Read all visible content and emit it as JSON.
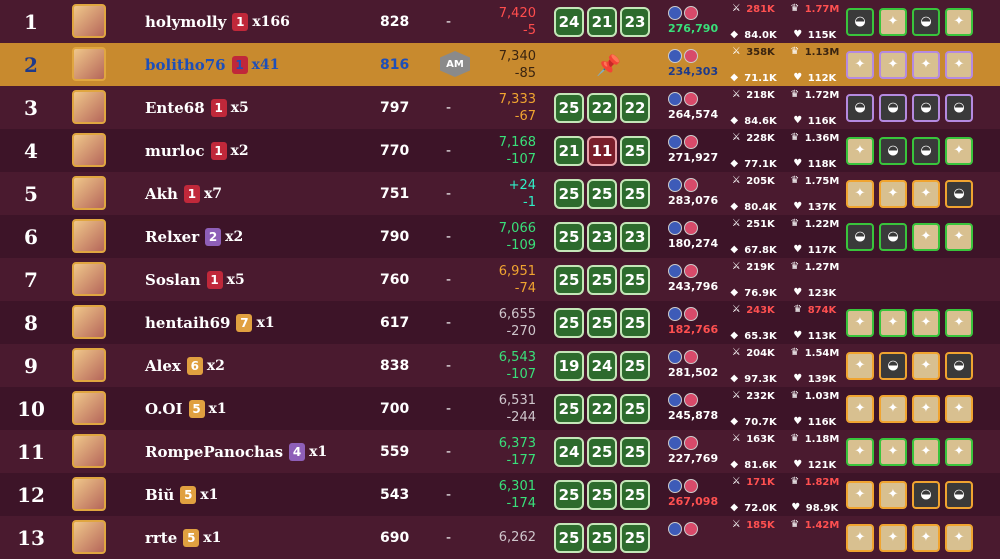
{
  "colors": {
    "accent": "#c88a2e",
    "green": "#39e07a",
    "red": "#ff4d4d"
  },
  "rows": [
    {
      "rank": "1",
      "name": "holymolly",
      "level": "1",
      "levelColor": "#c0283a",
      "mult": "x166",
      "rating": "828",
      "badge": "",
      "score1": "7,420",
      "score2": "-5",
      "scoreColor": "sc-red",
      "boxes": [
        "24",
        "21",
        "23"
      ],
      "redIndex": -1,
      "power": "276,790",
      "powerColor": "#39e07a",
      "s1": "281K",
      "s2": "84.0K",
      "s3": "1.77M",
      "s4": "115K",
      "s1Color": "#ff5050",
      "s3Color": "#ff5050",
      "team": [
        "dark",
        "light",
        "dark",
        "light"
      ],
      "teamBorder": "green",
      "flag": [
        "#000",
        "#dd0000",
        "#ffce00"
      ]
    },
    {
      "rank": "2",
      "name": "bolitho76",
      "level": "1",
      "levelColor": "#c0283a",
      "mult": "x41",
      "rating": "816",
      "badge": "AM",
      "score1": "7,340",
      "score2": "-85",
      "scoreColor": "sc-red",
      "boxes": [],
      "redIndex": -1,
      "power": "234,303",
      "powerColor": "#1e3a8a",
      "s1": "358K",
      "s2": "71.1K",
      "s3": "1.13M",
      "s4": "112K",
      "s1Color": "#3a2410",
      "s3Color": "#3a2410",
      "team": [
        "light",
        "light",
        "light",
        "light"
      ],
      "teamBorder": "purple",
      "flag": [
        "#000",
        "#dd0000",
        "#ffce00"
      ]
    },
    {
      "rank": "3",
      "name": "Ente68",
      "level": "1",
      "levelColor": "#c0283a",
      "mult": "x5",
      "rating": "797",
      "badge": "",
      "score1": "7,333",
      "score2": "-67",
      "scoreColor": "sc-orange",
      "boxes": [
        "25",
        "22",
        "22"
      ],
      "redIndex": -1,
      "power": "264,574",
      "powerColor": "#fff",
      "s1": "218K",
      "s2": "84.6K",
      "s3": "1.72M",
      "s4": "116K",
      "s1Color": "#fff",
      "s3Color": "#fff",
      "team": [
        "dark",
        "dark",
        "dark",
        "dark"
      ],
      "teamBorder": "purple",
      "flag": [
        "#c60b1e",
        "#ffc400",
        "#c60b1e"
      ]
    },
    {
      "rank": "4",
      "name": "murloc",
      "level": "1",
      "levelColor": "#c0283a",
      "mult": "x2",
      "rating": "770",
      "badge": "",
      "score1": "7,168",
      "score2": "-107",
      "scoreColor": "sc-green",
      "boxes": [
        "21",
        "11",
        "25"
      ],
      "redIndex": 1,
      "power": "271,927",
      "powerColor": "#fff",
      "s1": "228K",
      "s2": "77.1K",
      "s3": "1.36M",
      "s4": "118K",
      "s1Color": "#fff",
      "s3Color": "#fff",
      "team": [
        "light",
        "dark",
        "dark",
        "light"
      ],
      "teamBorder": "green",
      "flag": [
        "#0055a4",
        "#fff",
        "#ef4135"
      ]
    },
    {
      "rank": "5",
      "name": "Akh",
      "level": "1",
      "levelColor": "#c0283a",
      "mult": "x7",
      "rating": "751",
      "badge": "",
      "score1": "+24",
      "score2": "-1",
      "scoreColor": "sc-cyan",
      "boxes": [
        "25",
        "25",
        "25"
      ],
      "redIndex": -1,
      "power": "283,076",
      "powerColor": "#fff",
      "s1": "205K",
      "s2": "80.4K",
      "s3": "1.75M",
      "s4": "137K",
      "s1Color": "#fff",
      "s3Color": "#fff",
      "team": [
        "light",
        "light",
        "light",
        "dark"
      ],
      "teamBorder": "orange",
      "flag": [
        "#cd2a3e",
        "#fff",
        "#436f4d"
      ]
    },
    {
      "rank": "6",
      "name": "Relxer",
      "level": "2",
      "levelColor": "#8e5fb8",
      "mult": "x2",
      "rating": "790",
      "badge": "",
      "score1": "7,066",
      "score2": "-109",
      "scoreColor": "sc-green",
      "boxes": [
        "25",
        "23",
        "23"
      ],
      "redIndex": -1,
      "power": "180,274",
      "powerColor": "#fff",
      "s1": "251K",
      "s2": "67.8K",
      "s3": "1.22M",
      "s4": "117K",
      "s1Color": "#fff",
      "s3Color": "#fff",
      "team": [
        "dark",
        "dark",
        "light",
        "light"
      ],
      "teamBorder": "green",
      "flag": [
        "#000",
        "#dd0000",
        "#ffce00"
      ]
    },
    {
      "rank": "7",
      "name": "Soslan",
      "level": "1",
      "levelColor": "#c0283a",
      "mult": "x5",
      "rating": "760",
      "badge": "",
      "score1": "6,951",
      "score2": "-74",
      "scoreColor": "sc-orange",
      "boxes": [
        "25",
        "25",
        "25"
      ],
      "redIndex": -1,
      "power": "243,796",
      "powerColor": "#fff",
      "s1": "219K",
      "s2": "76.9K",
      "s3": "1.27M",
      "s4": "123K",
      "s1Color": "#fff",
      "s3Color": "#fff",
      "team": [],
      "teamBorder": "green",
      "flag": [
        "#b22234",
        "#fff",
        "#3c3b6e"
      ]
    },
    {
      "rank": "8",
      "name": "hentaih69",
      "level": "7",
      "levelColor": "#e0a040",
      "mult": "x1",
      "rating": "617",
      "badge": "",
      "score1": "6,655",
      "score2": "-270",
      "scoreColor": "sc-grey",
      "boxes": [
        "25",
        "25",
        "25"
      ],
      "redIndex": -1,
      "power": "182,766",
      "powerColor": "#ff5050",
      "s1": "243K",
      "s2": "65.3K",
      "s3": "874K",
      "s4": "113K",
      "s1Color": "#ff5050",
      "s3Color": "#ff5050",
      "team": [
        "light",
        "light",
        "light",
        "light"
      ],
      "teamBorder": "green",
      "flag": [
        "#0055a4",
        "#fff",
        "#ef4135"
      ]
    },
    {
      "rank": "9",
      "name": "Alex",
      "level": "6",
      "levelColor": "#e0a040",
      "mult": "x2",
      "rating": "838",
      "badge": "",
      "score1": "6,543",
      "score2": "-107",
      "scoreColor": "sc-green",
      "boxes": [
        "19",
        "24",
        "25"
      ],
      "redIndex": -1,
      "power": "281,502",
      "powerColor": "#fff",
      "s1": "204K",
      "s2": "97.3K",
      "s3": "1.54M",
      "s4": "139K",
      "s1Color": "#fff",
      "s3Color": "#fff",
      "team": [
        "light",
        "dark",
        "light",
        "dark"
      ],
      "teamBorder": "orange",
      "flag": [
        "#0d5eaf",
        "#fff",
        "#0d5eaf"
      ]
    },
    {
      "rank": "10",
      "name": "O.OI",
      "level": "5",
      "levelColor": "#e0a040",
      "mult": "x1",
      "rating": "700",
      "badge": "",
      "score1": "6,531",
      "score2": "-244",
      "scoreColor": "sc-grey",
      "boxes": [
        "25",
        "22",
        "25"
      ],
      "redIndex": -1,
      "power": "245,878",
      "powerColor": "#fff",
      "s1": "232K",
      "s2": "70.7K",
      "s3": "1.03M",
      "s4": "116K",
      "s1Color": "#fff",
      "s3Color": "#fff",
      "team": [
        "light",
        "light",
        "light",
        "light"
      ],
      "teamBorder": "orange",
      "flag": [
        "#ae1c28",
        "#fff",
        "#21468b"
      ]
    },
    {
      "rank": "11",
      "name": "RompePanochas",
      "level": "4",
      "levelColor": "#8e5fb8",
      "mult": "x1",
      "rating": "559",
      "badge": "",
      "score1": "6,373",
      "score2": "-177",
      "scoreColor": "sc-green",
      "boxes": [
        "24",
        "25",
        "25"
      ],
      "redIndex": -1,
      "power": "227,769",
      "powerColor": "#fff",
      "s1": "163K",
      "s2": "81.6K",
      "s3": "1.18M",
      "s4": "121K",
      "s1Color": "#fff",
      "s3Color": "#fff",
      "team": [
        "light",
        "light",
        "light",
        "light"
      ],
      "teamBorder": "green",
      "flag": [
        "#d91023",
        "#fff",
        "#d91023"
      ]
    },
    {
      "rank": "12",
      "name": "Biŭ",
      "level": "5",
      "levelColor": "#e0a040",
      "mult": "x1",
      "rating": "543",
      "badge": "",
      "score1": "6,301",
      "score2": "-174",
      "scoreColor": "sc-green",
      "boxes": [
        "25",
        "25",
        "25"
      ],
      "redIndex": -1,
      "power": "267,098",
      "powerColor": "#ff5050",
      "s1": "171K",
      "s2": "72.0K",
      "s3": "1.82M",
      "s4": "98.9K",
      "s1Color": "#ff5050",
      "s3Color": "#ff5050",
      "team": [
        "light",
        "light",
        "dark",
        "dark"
      ],
      "teamBorder": "orange",
      "flag": [
        "#0057b7",
        "#ffd700",
        "#ffd700"
      ]
    },
    {
      "rank": "13",
      "name": "rrte",
      "level": "5",
      "levelColor": "#e0a040",
      "mult": "x1",
      "rating": "690",
      "badge": "",
      "score1": "6,262",
      "score2": "",
      "scoreColor": "sc-grey",
      "boxes": [
        "25",
        "25",
        "25"
      ],
      "redIndex": -1,
      "power": "",
      "powerColor": "#fff",
      "s1": "185K",
      "s2": "",
      "s3": "1.42M",
      "s4": "",
      "s1Color": "#ff5050",
      "s3Color": "#ff5050",
      "team": [
        "light",
        "light",
        "light",
        "light"
      ],
      "teamBorder": "orange",
      "flag": [
        "#de2910",
        "#de2910",
        "#de2910"
      ]
    }
  ],
  "dash": "-",
  "pin_glyph": "📌"
}
